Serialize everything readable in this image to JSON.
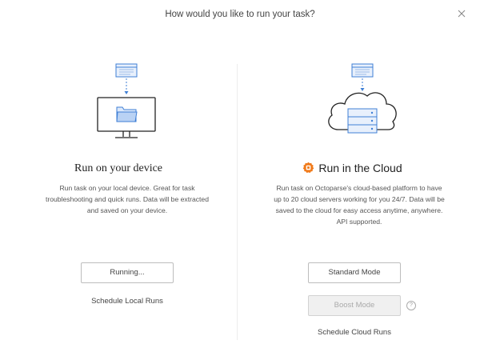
{
  "dialog": {
    "title": "How would you like to run your task?"
  },
  "local": {
    "heading": "Run on your device",
    "description": "Run task on your local device. Great for task troubleshooting and quick runs. Data will be extracted and saved on your device.",
    "running_button": "Running...",
    "schedule_link": "Schedule Local Runs"
  },
  "cloud": {
    "heading": "Run in the Cloud",
    "description": "Run task on Octoparse's cloud-based platform to have up to 20 cloud servers working for you 24/7. Data will be saved to the cloud for easy access anytime, anywhere. API supported.",
    "standard_button": "Standard Mode",
    "boost_button": "Boost Mode",
    "help_icon_text": "?",
    "schedule_link": "Schedule Cloud Runs"
  },
  "colors": {
    "accent_orange": "#f07a1a",
    "illustration_blue": "#3f7fd6",
    "illustration_light_blue": "#dce9fb"
  },
  "icons": {
    "close": "close-icon",
    "cloud_badge": "octoparse-badge-icon",
    "help": "question-circle-icon"
  }
}
